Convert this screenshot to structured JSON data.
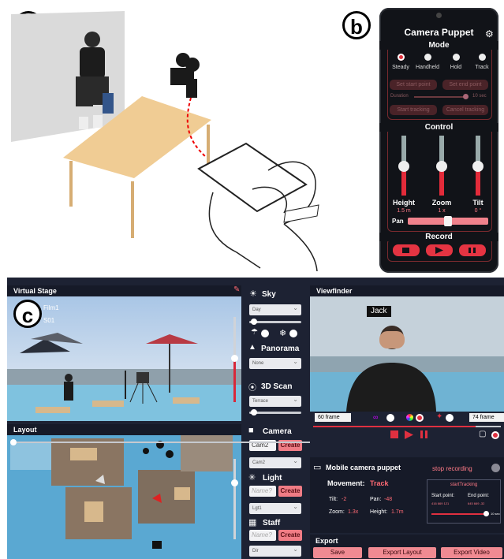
{
  "labels": {
    "a": "a",
    "b": "b",
    "c": "c"
  },
  "phone": {
    "title": "Camera Puppet",
    "settings_icon": "gear-icon",
    "mode": {
      "heading": "Mode",
      "options": [
        "Steady",
        "Handheld",
        "Hold",
        "Track"
      ],
      "selected": "Steady",
      "buttons": {
        "set_start": "Set start point",
        "set_end": "Set end point",
        "duration_label": "Duration",
        "duration_value": "10 sec",
        "start_tracking": "Start tracking",
        "cancel_tracking": "Cancel tracking"
      }
    },
    "control": {
      "heading": "Control",
      "sliders": [
        {
          "label": "Height",
          "value": "1.5 m"
        },
        {
          "label": "Zoom",
          "value": "1 x"
        },
        {
          "label": "Tilt",
          "value": "0 °"
        }
      ],
      "pan_label": "Pan"
    },
    "record": {
      "heading": "Record",
      "buttons": [
        "stop-icon",
        "play-icon",
        "pause-icon"
      ]
    }
  },
  "app": {
    "virtual_stage": {
      "title": "Virtual Stage",
      "film": "Film1",
      "shot": "S01",
      "edit_icon": "pencil-icon"
    },
    "layout": {
      "title": "Layout"
    },
    "sidebar": {
      "sky": {
        "heading": "Sky",
        "value": "Day"
      },
      "panorama": {
        "heading": "Panorama",
        "value": "None"
      },
      "scan": {
        "heading": "3D Scan",
        "value": "Terrace"
      },
      "camera": {
        "heading": "Camera",
        "input_value": "Cam2",
        "create": "Create",
        "select_value": "Cam2"
      },
      "light": {
        "heading": "Light",
        "placeholder": "Name?",
        "create": "Create",
        "select_value": "Lgt1"
      },
      "staff": {
        "heading": "Staff",
        "placeholder": "Name?",
        "create": "Create",
        "select_value": "Dir"
      }
    },
    "viewfinder": {
      "title": "Viewfinder",
      "subject_label": "Jack",
      "frame_start": "60 frame",
      "frame_end": "74 frame"
    },
    "mobile": {
      "title": "Mobile camera puppet",
      "stop": "stop recording",
      "movement_label": "Movement:",
      "movement_value": "Track",
      "tilt_label": "Tilt:",
      "tilt_value": "-2",
      "pan_label": "Pan:",
      "pan_value": "-48",
      "zoom_label": "Zoom:",
      "zoom_value": "1.3x",
      "height_label": "Height:",
      "height_value": "1.7m",
      "tracking_title": "startTracking",
      "start_point_label": "Start point:",
      "start_point_value": "416 669 121",
      "end_point_label": "End point:",
      "end_point_value": "645 669 -32",
      "duration_value": "10 sec"
    },
    "export": {
      "title": "Export",
      "buttons": [
        "Save",
        "Export Layout",
        "Export Video"
      ]
    }
  }
}
